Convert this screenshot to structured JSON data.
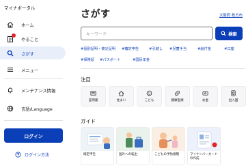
{
  "app": {
    "title": "マイナポータル"
  },
  "sidebar": {
    "items": [
      {
        "label": "ホーム",
        "icon": "home-icon"
      },
      {
        "label": "やること",
        "icon": "task-icon"
      },
      {
        "label": "さがす",
        "icon": "search-icon"
      },
      {
        "label": "メニュー",
        "icon": "menu-icon"
      }
    ],
    "secondary": [
      {
        "label": "メンテナンス情報",
        "icon": "bell-icon"
      },
      {
        "label": "言語/Language",
        "icon": "globe-icon"
      }
    ],
    "login_label": "ログイン",
    "login_help_label": "ログイン方法"
  },
  "main": {
    "heading": "さがす",
    "region_link": "大阪府 枚方市",
    "search": {
      "placeholder": "キーワード",
      "button_label": "検索"
    },
    "tags": [
      "#確定申告",
      "#引越し",
      "#児童手当",
      "#給付金",
      "#口座",
      "#保険証",
      "#パスポート",
      "#国民年金"
    ],
    "tag_long_prefix": "#確定申告",
    "featured_title": "注目",
    "featured": [
      {
        "label": "証明書",
        "icon": "certificate-icon"
      },
      {
        "label": "住まい",
        "icon": "house-icon"
      },
      {
        "label": "こども",
        "icon": "child-icon"
      },
      {
        "label": "健康医療",
        "icon": "medical-icon"
      },
      {
        "label": "お金",
        "icon": "money-icon"
      },
      {
        "label": "出入国",
        "icon": "passport-icon"
      }
    ],
    "guide_title": "ガイド",
    "guides": [
      {
        "label": "確定申告"
      },
      {
        "label": "国外への転出"
      },
      {
        "label": "こどもの予防接種"
      },
      {
        "label": "マイナンバーカードの作成"
      }
    ]
  },
  "colors": {
    "primary": "#0b3fb8",
    "badge": "#e0242a",
    "active_bg": "#e9eefb"
  }
}
